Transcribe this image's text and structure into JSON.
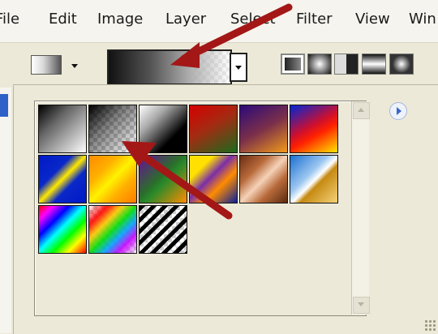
{
  "menubar": {
    "items": [
      {
        "label": "File",
        "name": "menu-file"
      },
      {
        "label": "Edit",
        "name": "menu-edit"
      },
      {
        "label": "Image",
        "name": "menu-image"
      },
      {
        "label": "Layer",
        "name": "menu-layer"
      },
      {
        "label": "Select",
        "name": "menu-select"
      },
      {
        "label": "Filter",
        "name": "menu-filter"
      },
      {
        "label": "View",
        "name": "menu-view"
      },
      {
        "label": "Win",
        "name": "menu-window"
      }
    ]
  },
  "options_bar": {
    "tool_type_icons": [
      "linear-gradient-icon",
      "radial-gradient-icon",
      "angle-gradient-icon",
      "reflected-gradient-icon",
      "diamond-gradient-icon"
    ],
    "current_gradient": "black-white-transparent-gradient"
  },
  "gradient_picker": {
    "swatches": [
      "black-white",
      "black-transparent",
      "black-white-reverse",
      "red-green",
      "violet-orange",
      "blue-red-yellow",
      "blue-yellow-blue",
      "orange-yellow-orange",
      "violet-green-orange",
      "yellow-violet-orange-blue",
      "copper",
      "chrome",
      "spectrum",
      "transparent-rainbow",
      "transparent-stripes"
    ],
    "scroll_up_icon": "scroll-up-arrow-icon",
    "scroll_down_icon": "scroll-down-arrow-icon",
    "menu_icon": "panel-menu-arrow-icon"
  },
  "annotations": {
    "arrow_color": "#a41717"
  }
}
